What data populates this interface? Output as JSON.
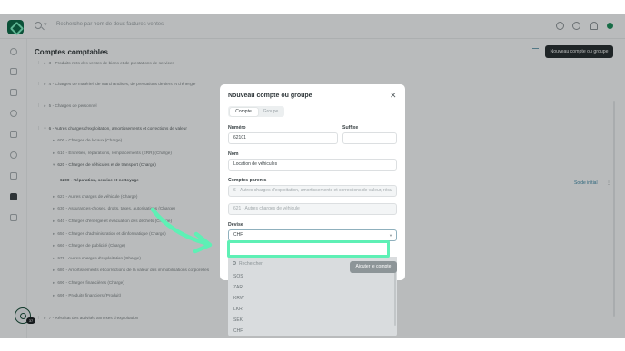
{
  "app": {
    "search_placeholder": "Recherche par nom de deux factures ventes",
    "fab_badge": "37"
  },
  "page": {
    "title": "Comptes comptables",
    "new_button": "Nouveau compte ou groupe",
    "balance_link": "Solde initial",
    "rows": [
      "3 - Produits nets des ventes de biens et de prestations de services",
      "4 - Charges de matériel, de marchandises, de prestations de tiers et d'énergie",
      "5 - Charges de personnel",
      "6 - Autres charges d'exploitation, amortissements et corrections de valeur",
      "600 - Charges de locaux (Charge)",
      "610 - Entretien, réparations, remplacements (ERR) (Charge)",
      "620 - Charges de véhicules et de transport (Charge)",
      "6200 - Réparation, service et nettoyage",
      "621 - Autres charges de véhicule (Charge)",
      "630 - Assurances-choses, droits, taxes, autorisations (Charge)",
      "640 - Charges d'énergie et évacuation des déchets (Charge)",
      "650 - Charges d'administration et d'informatique (Charge)",
      "660 - Charges de publicité (Charge)",
      "670 - Autres charges d'exploitation (Charge)",
      "680 - Amortissements et corrections de la valeur des immobilisations corporelles",
      "690 - Charges financières (Charge)",
      "695 - Produits financiers (Produit)",
      "7 - Résultat des activités annexes d'exploitation"
    ]
  },
  "modal": {
    "title": "Nouveau compte ou groupe",
    "tabs": [
      "Compte",
      "Groupe"
    ],
    "numero_label": "Numéro",
    "numero_value": "62101",
    "suffixe_label": "Suffixe",
    "suffixe_value": "",
    "nom_label": "Nom",
    "nom_value": "Location de véhicules",
    "parents_label": "Comptes parents",
    "parent_1": "6 - Autres charges d'exploitation, amortissements et corrections de valeur, résu",
    "parent_2": "621 - Autres charges de véhicule",
    "devise_label": "Devise",
    "devise_value": "CHF",
    "dropdown_search": "Rechercher",
    "dropdown_options": [
      "SOS",
      "ZAR",
      "KRW",
      "LKR",
      "SEK",
      "CHF"
    ],
    "submit": "Ajouter le compte"
  },
  "colors": {
    "accent_green": "#5ef0b5",
    "primary_dark": "#2a3134",
    "link_blue": "#3b86a3"
  }
}
